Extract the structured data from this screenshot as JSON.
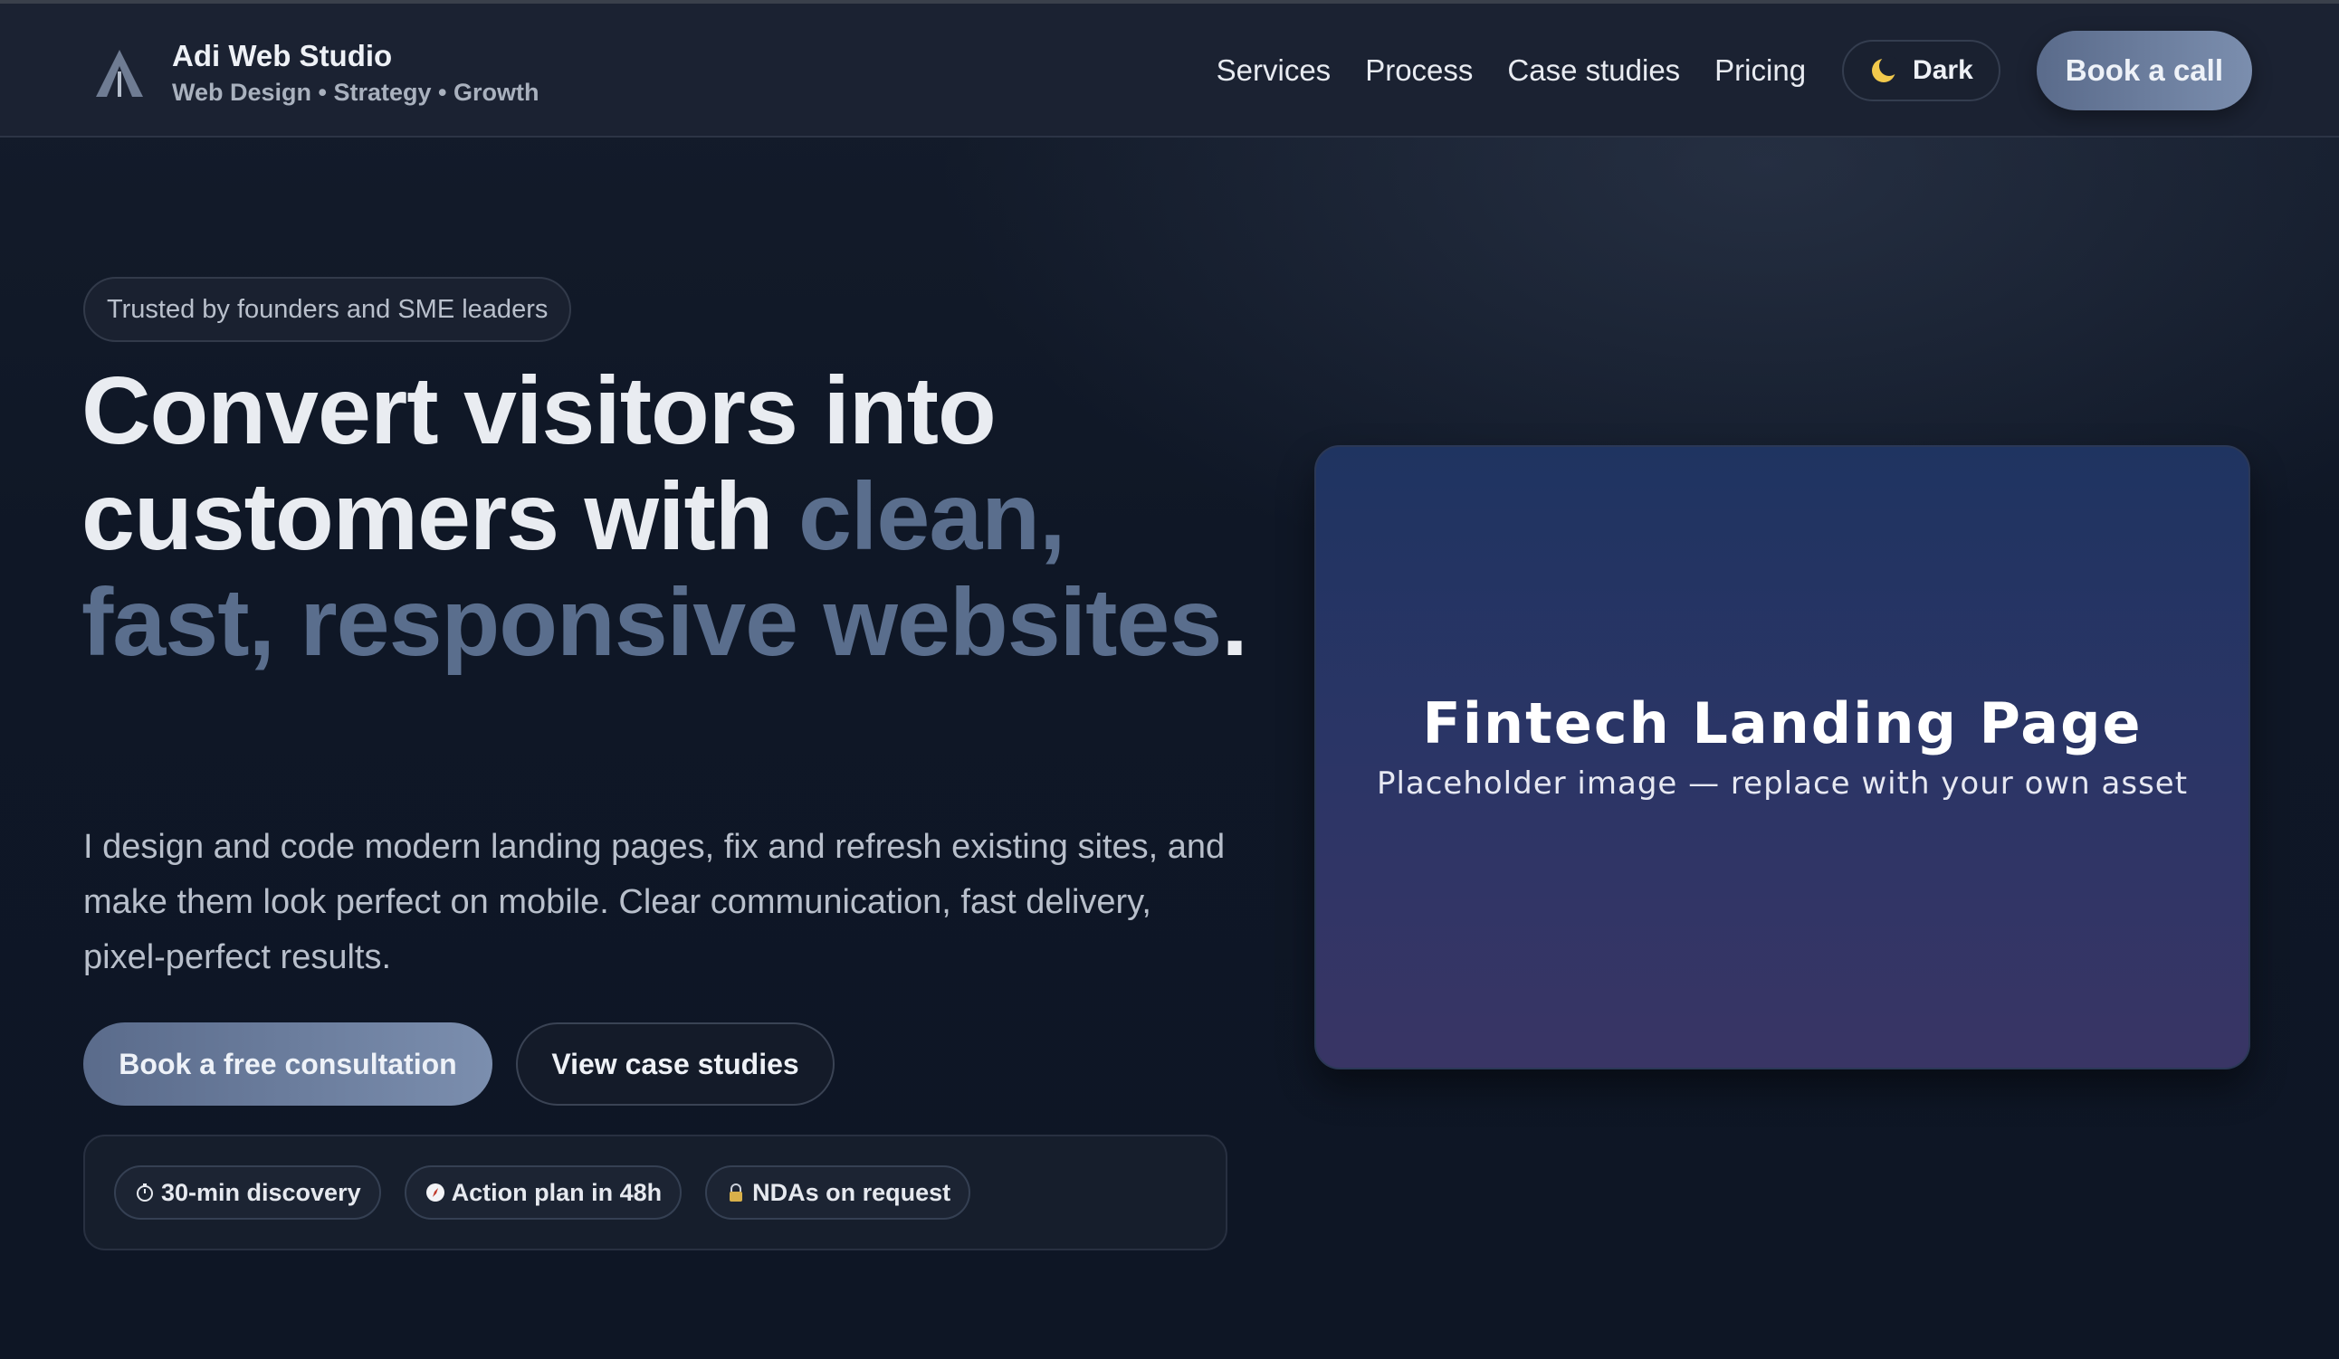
{
  "header": {
    "brand_name": "Adi Web Studio",
    "brand_tagline": "Web Design • Strategy • Growth",
    "logo_icon": "mountain-a-logo",
    "nav": [
      "Services",
      "Process",
      "Case studies",
      "Pricing"
    ],
    "theme_toggle": {
      "icon": "moon-icon",
      "label": "Dark"
    },
    "cta_label": "Book a call"
  },
  "hero": {
    "badge": "Trusted by founders and SME leaders",
    "headline_part1": "Convert visitors into customers with ",
    "headline_accent": "clean, fast, responsive websites",
    "headline_end": ".",
    "lead": "I design and code modern landing pages, fix and refresh existing sites, and make them look perfect on mobile. Clear communication, fast delivery, pixel-perfect results.",
    "primary_cta": "Book a free consultation",
    "secondary_cta": "View case studies",
    "chips": [
      {
        "icon": "stopwatch-icon",
        "label": "30-min discovery"
      },
      {
        "icon": "compass-icon",
        "label": "Action plan in 48h"
      },
      {
        "icon": "lock-icon",
        "label": "NDAs on request"
      }
    ]
  },
  "showcase": {
    "title": "Fintech Landing Page",
    "subtitle": "Placeholder image — replace with your own asset"
  },
  "colors": {
    "background": "#101828",
    "header": "#1b2232",
    "accent": "#5a6e8d",
    "button_gradient_start": "#5a6b8b",
    "button_gradient_end": "#7b8eae",
    "card_top": "#1f3461",
    "card_bottom": "#393565"
  }
}
